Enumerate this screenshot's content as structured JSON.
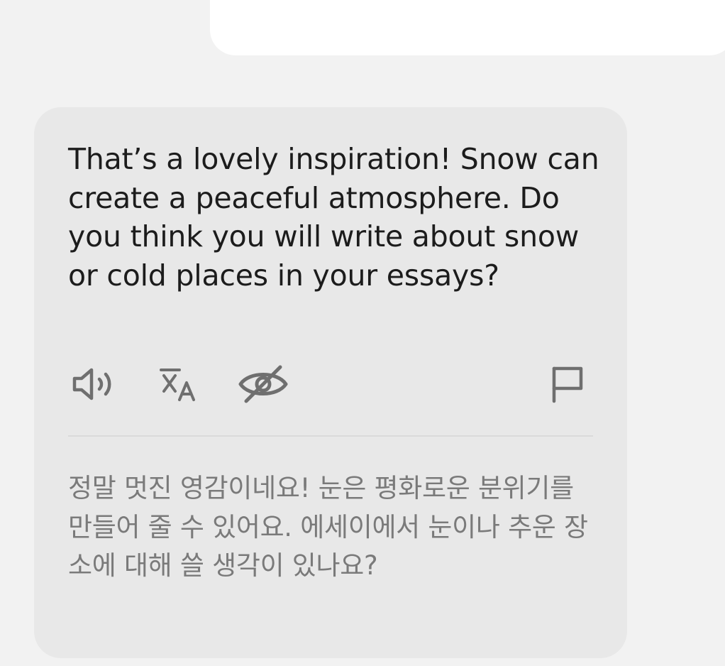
{
  "message": {
    "text": "That’s a lovely inspiration! Snow can create a peaceful atmosphere. Do you think you will write about snow or cold places in your essays?",
    "translation": "정말 멋진 영감이네요! 눈은 평화로운 분위기를 만들어 줄 수 있어요. 에세이에서 눈이나 추운 장소에 대해 쓸 생각이 있나요?"
  },
  "actions": [
    {
      "name": "speaker-icon"
    },
    {
      "name": "translate-icon"
    },
    {
      "name": "eye-off-icon"
    },
    {
      "name": "flag-icon"
    }
  ],
  "colors": {
    "background": "#f2f2f2",
    "bubble": "#e8e8e8",
    "text": "#1c1c1c",
    "translation_text": "#7a7a7a",
    "icon": "#6f6f6f"
  }
}
